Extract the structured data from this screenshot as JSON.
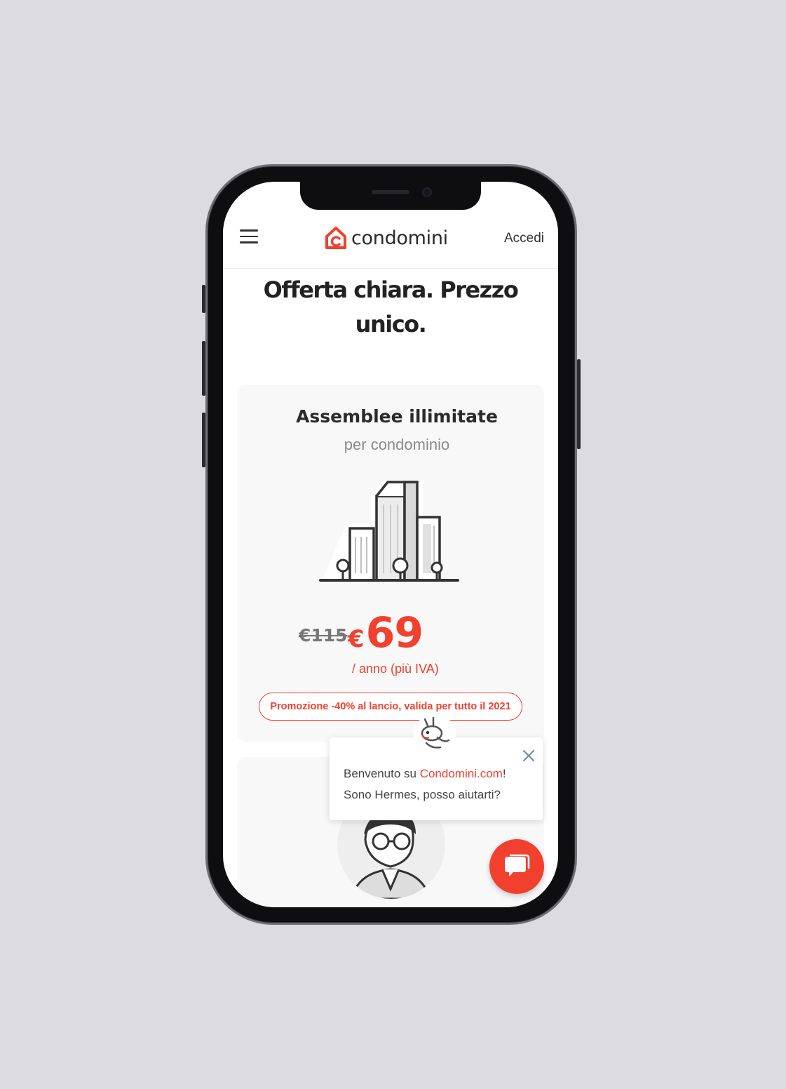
{
  "header": {
    "logo_text": "condomini",
    "login_label": "Accedi"
  },
  "hero": {
    "title_line1": "Offerta chiara. Prezzo",
    "title_line2": "unico."
  },
  "pricing_card": {
    "title": "Assemblee illimitate",
    "subtitle": "per condominio",
    "old_price": "€115",
    "currency": "€",
    "new_price": "69",
    "period": "/ anno (più IVA)",
    "promo": "Promozione -40% al lancio, valida per tutto il 2021"
  },
  "chat": {
    "greeting_prefix": "Benvenuto su ",
    "greeting_brand": "Condomini.com",
    "greeting_suffix": "!",
    "question": "Sono Hermes, posso aiutarti?"
  },
  "colors": {
    "accent": "#f2402e",
    "text": "#222222",
    "card_bg": "#f8f8f8",
    "background": "#dcdce0"
  },
  "icons": {
    "menu": "hamburger-menu-icon",
    "logo": "house-logo-icon",
    "illustration": "buildings-illustration-icon",
    "close": "close-icon",
    "chat": "chat-bubble-icon"
  }
}
